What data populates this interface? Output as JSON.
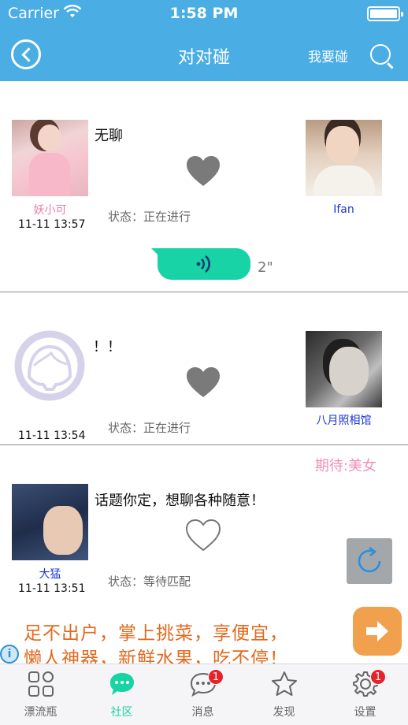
{
  "status_bar": {
    "carrier": "Carrier",
    "time": "1:58 PM"
  },
  "nav": {
    "title": "对对碰",
    "action_label": "我要碰",
    "back_icon": "back-circle-icon",
    "search_icon": "search-icon"
  },
  "cards": [
    {
      "message": "无聊",
      "left_name": "妖小可",
      "left_time": "11-11 13:57",
      "right_name": "Ifan",
      "status": "状态：正在进行",
      "heart": "filled",
      "voice_duration": "2\""
    },
    {
      "message": "！！",
      "left_time": "11-11 13:54",
      "right_name": "八月照相馆",
      "status": "状态：正在进行",
      "heart": "filled"
    },
    {
      "expectation": "期待:美女",
      "message": "话题你定，想聊各种随意！",
      "left_name": "大猛",
      "left_time": "11-11 13:51",
      "status": "状态：等待匹配",
      "heart": "outline"
    }
  ],
  "ad": {
    "line1": "足不出户，掌上挑菜，享便宜，",
    "line2": "懒人神器，新鲜水果，吃不停！",
    "info_glyph": "i"
  },
  "tabbar": {
    "items": [
      {
        "label": "漂流瓶",
        "icon": "grid-icon",
        "active": false
      },
      {
        "label": "社区",
        "icon": "chat-bubble-icon",
        "active": true
      },
      {
        "label": "消息",
        "icon": "message-icon",
        "active": false,
        "badge": "1"
      },
      {
        "label": "发现",
        "icon": "star-icon",
        "active": false
      },
      {
        "label": "设置",
        "icon": "gear-icon",
        "active": false,
        "badge": "1"
      }
    ]
  },
  "colors": {
    "nav_bg": "#4aade4",
    "accent_green": "#17d3a6",
    "pink": "#f07aa0",
    "blue_name": "#1a35d6",
    "ad_orange": "#e26a1f",
    "badge_red": "#e8222c"
  }
}
